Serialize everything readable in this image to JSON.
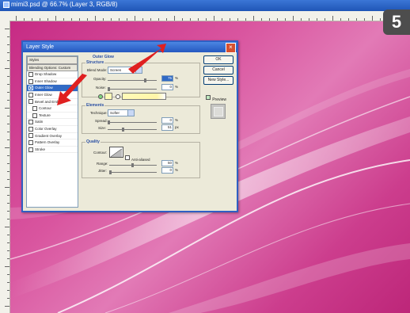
{
  "window": {
    "title": "mimi3.psd @ 66.7% (Layer 3, RGB/8)",
    "step_number": "5"
  },
  "dialog": {
    "title": "Layer Style",
    "close_glyph": "×",
    "styles_header": "Styles",
    "blending_options": "Blending Options: Custom",
    "effects": [
      {
        "label": "Drop Shadow",
        "checked": false,
        "indent": false,
        "selected": false
      },
      {
        "label": "Inner Shadow",
        "checked": false,
        "indent": false,
        "selected": false
      },
      {
        "label": "Outer Glow",
        "checked": true,
        "indent": false,
        "selected": true
      },
      {
        "label": "Inner Glow",
        "checked": false,
        "indent": false,
        "selected": false
      },
      {
        "label": "Bevel and Emboss",
        "checked": false,
        "indent": false,
        "selected": false
      },
      {
        "label": "Contour",
        "checked": false,
        "indent": true,
        "selected": false
      },
      {
        "label": "Texture",
        "checked": false,
        "indent": true,
        "selected": false
      },
      {
        "label": "Satin",
        "checked": false,
        "indent": false,
        "selected": false
      },
      {
        "label": "Color Overlay",
        "checked": false,
        "indent": false,
        "selected": false
      },
      {
        "label": "Gradient Overlay",
        "checked": false,
        "indent": false,
        "selected": false
      },
      {
        "label": "Pattern Overlay",
        "checked": false,
        "indent": false,
        "selected": false
      },
      {
        "label": "Stroke",
        "checked": false,
        "indent": false,
        "selected": false
      }
    ],
    "panel_title": "Outer Glow",
    "structure": {
      "label": "Structure",
      "blend_mode_label": "Blend Mode:",
      "blend_mode_value": "Screen",
      "opacity_label": "Opacity:",
      "opacity_value": "75",
      "noise_label": "Noise:",
      "noise_value": "0",
      "unit": "%"
    },
    "elements": {
      "label": "Elements",
      "technique_label": "Technique:",
      "technique_value": "Softer",
      "spread_label": "Spread:",
      "spread_value": "0",
      "size_label": "Size:",
      "size_value": "51",
      "spread_unit": "%",
      "size_unit": "px"
    },
    "quality": {
      "label": "Quality",
      "contour_label": "Contour:",
      "anti_aliased_label": "Anti-aliased",
      "range_label": "Range:",
      "range_value": "50",
      "jitter_label": "Jitter:",
      "jitter_value": "0",
      "unit": "%"
    },
    "buttons": {
      "ok": "OK",
      "cancel": "Cancel",
      "new_style": "New Style...",
      "preview": "Preview"
    },
    "glow_color": "#fffbb8"
  },
  "colors": {
    "canvas_magenta": "#c62b84",
    "accent_red": "#e02020",
    "selection_blue": "#316ac5"
  }
}
